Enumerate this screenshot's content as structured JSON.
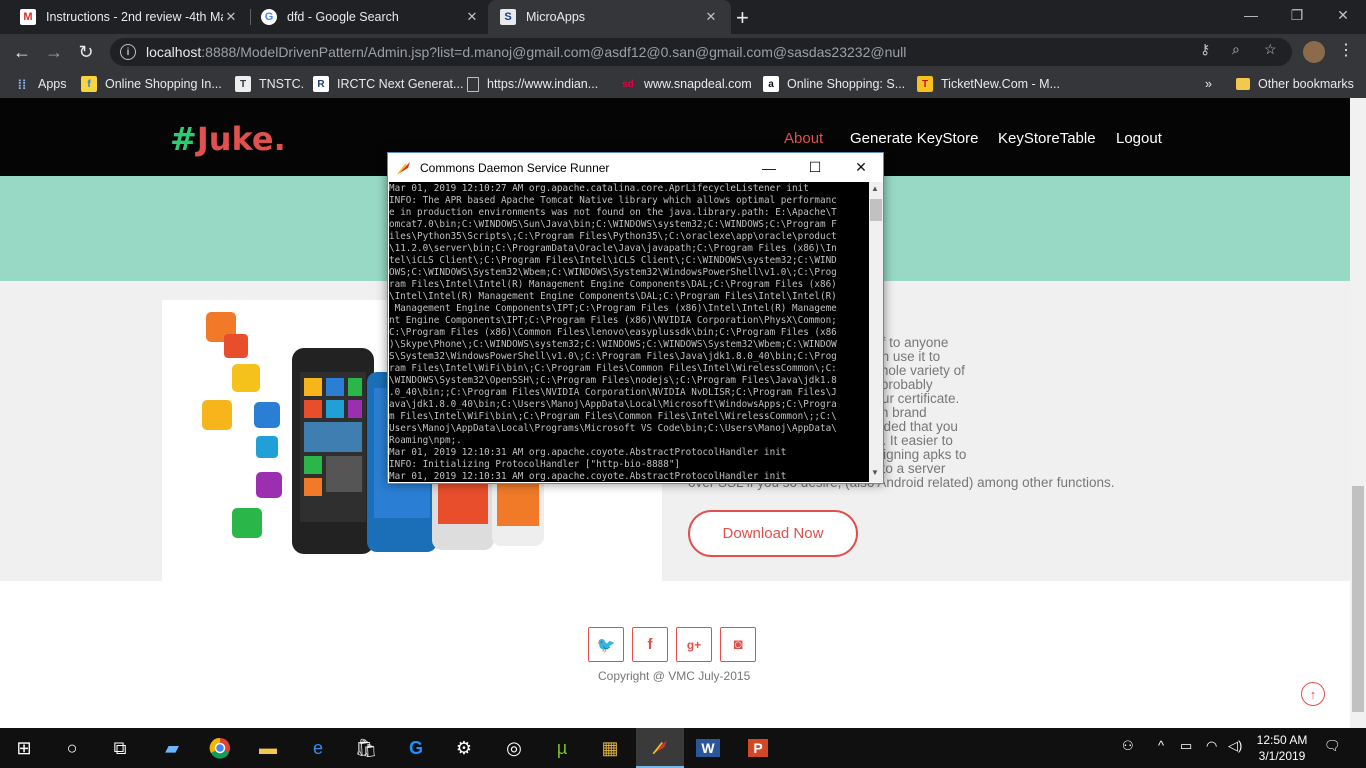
{
  "browser": {
    "tabs": [
      {
        "title": "Instructions - 2nd review -4th Ma",
        "icon": "gmail-icon",
        "active": false
      },
      {
        "title": "dfd - Google Search",
        "icon": "google-icon",
        "active": false
      },
      {
        "title": "MicroApps",
        "icon": "s-icon",
        "active": true
      }
    ],
    "url_host": "localhost",
    "url_rest": ":8888/ModelDrivenPattern/Admin.jsp?list=d.manoj@gmail.com@asdf12@0.san@gmail.com@sasdas23232@null",
    "bookmarks": [
      {
        "label": "Apps",
        "icon": "apps-grid-icon"
      },
      {
        "label": "Online Shopping In...",
        "icon": "flipkart-icon"
      },
      {
        "label": "TNSTC.",
        "icon": "tnstc-icon"
      },
      {
        "label": "IRCTC Next Generat...",
        "icon": "irctc-icon"
      },
      {
        "label": "https://www.indian...",
        "icon": "page-icon"
      },
      {
        "label": "www.snapdeal.com",
        "icon": "snapdeal-icon"
      },
      {
        "label": "Online Shopping: S...",
        "icon": "amazon-icon"
      },
      {
        "label": "TicketNew.Com - M...",
        "icon": "ticketnew-icon"
      }
    ],
    "overflow_label": "»",
    "other_bookmarks": "Other bookmarks"
  },
  "site": {
    "logo_hash": "#",
    "logo_name": "Juke.",
    "nav": [
      "About",
      "Generate KeyStore",
      "KeyStoreTable",
      "Logout"
    ],
    "description": "ore file is to authenticate yourself to anyone\nl to just signing .apk files, you can use it to\nn data to be transmitted and a whole variety of\nat you do with it for Android and probably\nou mention signing apk's, it is your certificate.\nion with your credentials. You can brand\nsame key, in fact, it is recommended that you\nultiple applications that you write. It easier to\ns belong to you. But apart from signing apks to\nse it to authenticate your device to a server\nover SSL if you so desire, (also Android related) among other functions.",
    "download_label": "Download Now",
    "social": [
      "twitter-icon",
      "facebook-icon",
      "google-plus-icon",
      "instagram-icon"
    ],
    "copyright": "Copyright @ VMC July-2015"
  },
  "console": {
    "title": "Commons Daemon Service Runner",
    "lines": [
      "Mar 01, 2019 12:10:27 AM org.apache.catalina.core.AprLifecycleListener init",
      "INFO: The APR based Apache Tomcat Native library which allows optimal performanc",
      "e in production environments was not found on the java.library.path: E:\\Apache\\T",
      "omcat7.0\\bin;C:\\WINDOWS\\Sun\\Java\\bin;C:\\WINDOWS\\system32;C:\\WINDOWS;C:\\Program F",
      "iles\\Python35\\Scripts\\;C:\\Program Files\\Python35\\;C:\\oraclexe\\app\\oracle\\product",
      "\\11.2.0\\server\\bin;C:\\ProgramData\\Oracle\\Java\\javapath;C:\\Program Files (x86)\\In",
      "tel\\iCLS Client\\;C:\\Program Files\\Intel\\iCLS Client\\;C:\\WINDOWS\\system32;C:\\WIND",
      "OWS;C:\\WINDOWS\\System32\\Wbem;C:\\WINDOWS\\System32\\WindowsPowerShell\\v1.0\\;C:\\Prog",
      "ram Files\\Intel\\Intel(R) Management Engine Components\\DAL;C:\\Program Files (x86)",
      "\\Intel\\Intel(R) Management Engine Components\\DAL;C:\\Program Files\\Intel\\Intel(R)",
      " Management Engine Components\\IPT;C:\\Program Files (x86)\\Intel\\Intel(R) Manageme",
      "nt Engine Components\\IPT;C:\\Program Files (x86)\\NVIDIA Corporation\\PhysX\\Common;",
      "C:\\Program Files (x86)\\Common Files\\lenovo\\easyplussdk\\bin;C:\\Program Files (x86",
      ")\\Skype\\Phone\\;C:\\WINDOWS\\system32;C:\\WINDOWS;C:\\WINDOWS\\System32\\Wbem;C:\\WINDOW",
      "S\\System32\\WindowsPowerShell\\v1.0\\;C:\\Program Files\\Java\\jdk1.8.0_40\\bin;C:\\Prog",
      "ram Files\\Intel\\WiFi\\bin\\;C:\\Program Files\\Common Files\\Intel\\WirelessCommon\\;C:",
      "\\WINDOWS\\System32\\OpenSSH\\;C:\\Program Files\\nodejs\\;C:\\Program Files\\Java\\jdk1.8",
      ".0_40\\bin;;C:\\Program Files\\NVIDIA Corporation\\NVIDIA NvDLISR;C:\\Program Files\\J",
      "ava\\jdk1.8.0_40\\bin;C:\\Users\\Manoj\\AppData\\Local\\Microsoft\\WindowsApps;C:\\Progra",
      "m Files\\Intel\\WiFi\\bin\\;C:\\Program Files\\Common Files\\Intel\\WirelessCommon\\;;C:\\",
      "Users\\Manoj\\AppData\\Local\\Programs\\Microsoft VS Code\\bin;C:\\Users\\Manoj\\AppData\\",
      "Roaming\\npm;.",
      "Mar 01, 2019 12:10:31 AM org.apache.coyote.AbstractProtocolHandler init",
      "INFO: Initializing ProtocolHandler [\"http-bio-8888\"]",
      "Mar 01, 2019 12:10:31 AM org.apache.coyote.AbstractProtocolHandler init"
    ]
  },
  "taskbar": {
    "time": "12:50 AM",
    "date": "3/1/2019"
  },
  "colors": {
    "accent_red": "#e0504c",
    "logo_green": "#2ecc71",
    "band_teal": "#98d9c6"
  }
}
